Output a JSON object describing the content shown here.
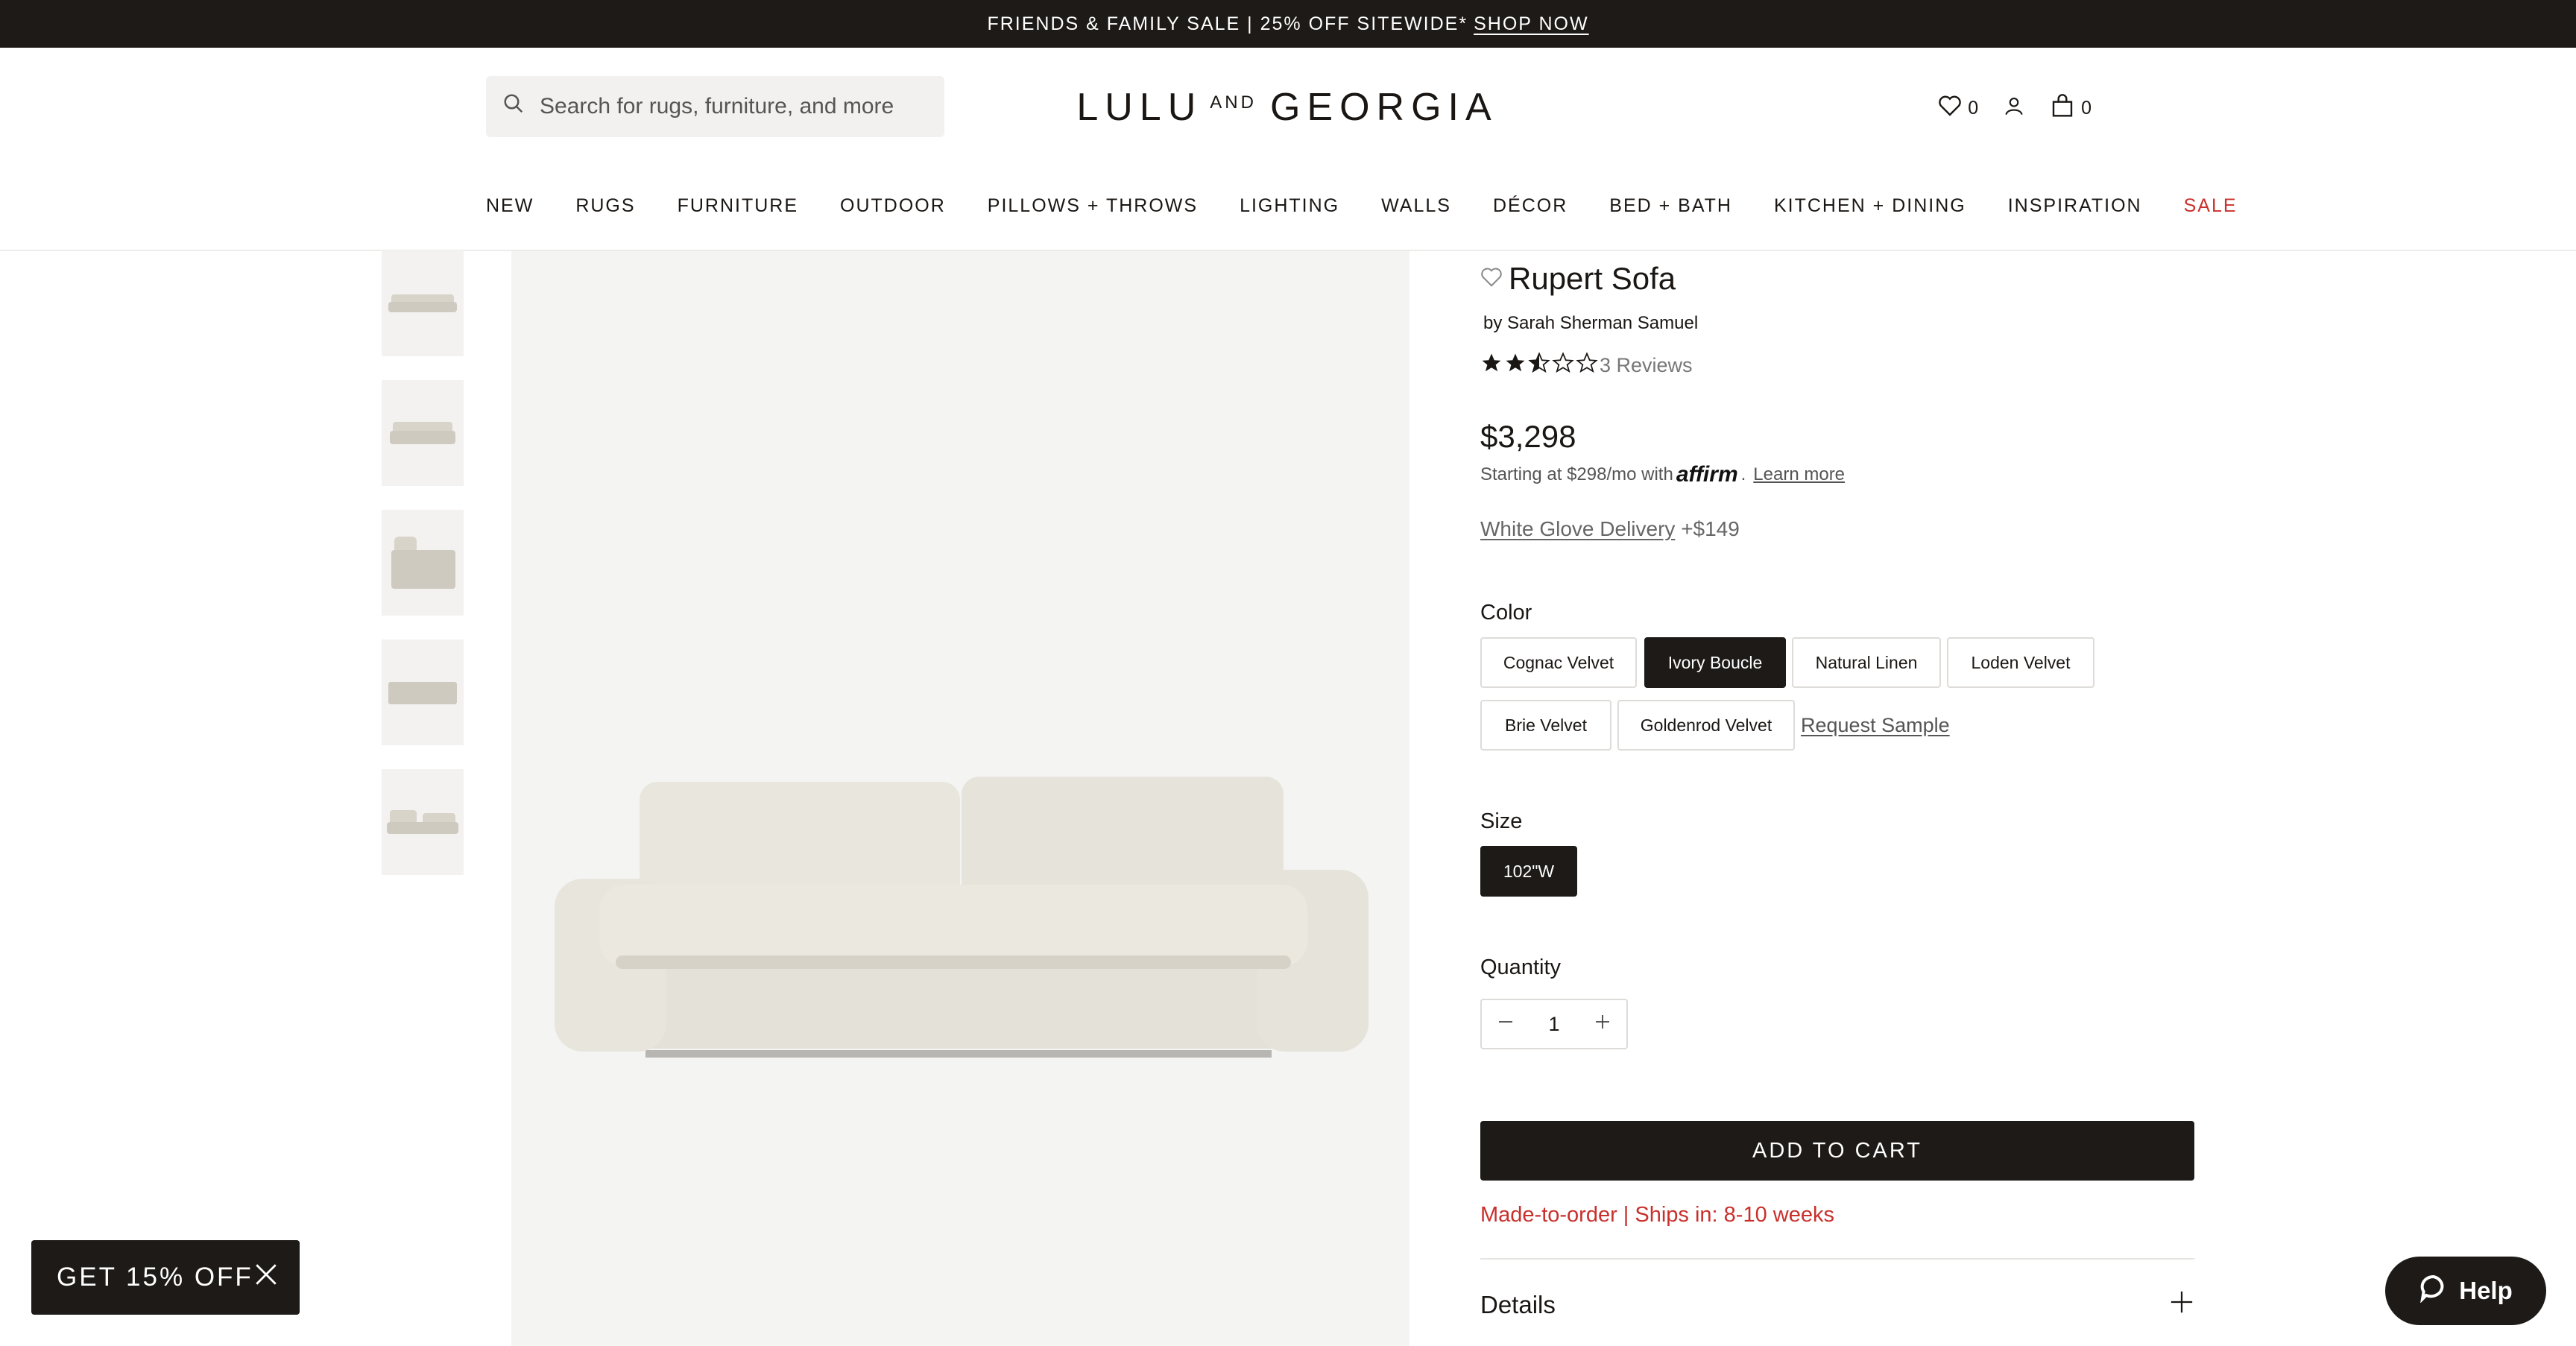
{
  "announcement": {
    "text": "FRIENDS & FAMILY SALE | 25% OFF SITEWIDE*",
    "link": "SHOP NOW"
  },
  "header": {
    "search_placeholder": "Search for rugs, furniture, and more",
    "logo_left": "LULU",
    "logo_mid": "AND",
    "logo_right": "GEORGIA",
    "wishlist_count": "0",
    "cart_count": "0"
  },
  "nav": {
    "items": [
      "NEW",
      "RUGS",
      "FURNITURE",
      "OUTDOOR",
      "PILLOWS + THROWS",
      "LIGHTING",
      "WALLS",
      "DÉCOR",
      "BED + BATH",
      "KITCHEN + DINING",
      "INSPIRATION",
      "SALE"
    ]
  },
  "product": {
    "title": "Rupert Sofa",
    "designer": "by Sarah Sherman Samuel",
    "rating": 2.5,
    "reviews": "3 Reviews",
    "price": "$3,298",
    "financing_text": "Starting at $298/mo with",
    "financing_brand": "affirm",
    "financing_link": "Learn more",
    "delivery_link": "White Glove Delivery",
    "delivery_price": "+$149",
    "color_label": "Color",
    "colors": [
      "Cognac Velvet",
      "Ivory Boucle",
      "Natural Linen",
      "Loden Velvet",
      "Brie Velvet",
      "Goldenrod Velvet"
    ],
    "selected_color": "Ivory Boucle",
    "request_sample": "Request Sample",
    "size_label": "Size",
    "size": "102\"W",
    "quantity_label": "Quantity",
    "quantity": "1",
    "add_to_cart": "ADD TO CART",
    "shipping": "Made-to-order | Ships in: 8-10 weeks",
    "details_label": "Details"
  },
  "promo": {
    "text": "GET 15% OFF"
  },
  "help": {
    "text": "Help"
  },
  "colors": {
    "dark": "#1d1a17",
    "sale": "#c9302c",
    "image_bg": "#f4f4f3"
  }
}
